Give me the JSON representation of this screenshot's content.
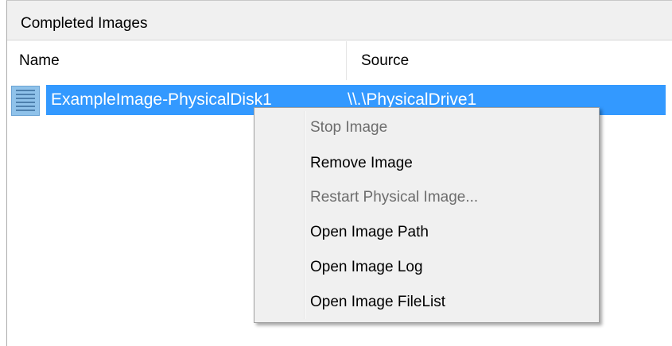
{
  "panel": {
    "title": "Completed Images"
  },
  "columns": {
    "name": "Name",
    "source": "Source"
  },
  "rows": [
    {
      "name": "ExampleImage-PhysicalDisk1",
      "source": "\\\\.\\PhysicalDrive1",
      "icon": "disk-image-icon"
    }
  ],
  "context_menu": {
    "items": [
      {
        "label": "Stop Image",
        "enabled": false
      },
      {
        "label": "Remove Image",
        "enabled": true
      },
      {
        "label": "Restart Physical Image...",
        "enabled": false
      },
      {
        "label": "Open Image Path",
        "enabled": true
      },
      {
        "label": "Open Image Log",
        "enabled": true
      },
      {
        "label": "Open Image FileList",
        "enabled": true
      }
    ]
  },
  "colors": {
    "selection": "#3399ff",
    "menu_background": "#f0f0f0",
    "header_background": "#f0f0f0",
    "disabled_text": "#6d6d6d"
  }
}
